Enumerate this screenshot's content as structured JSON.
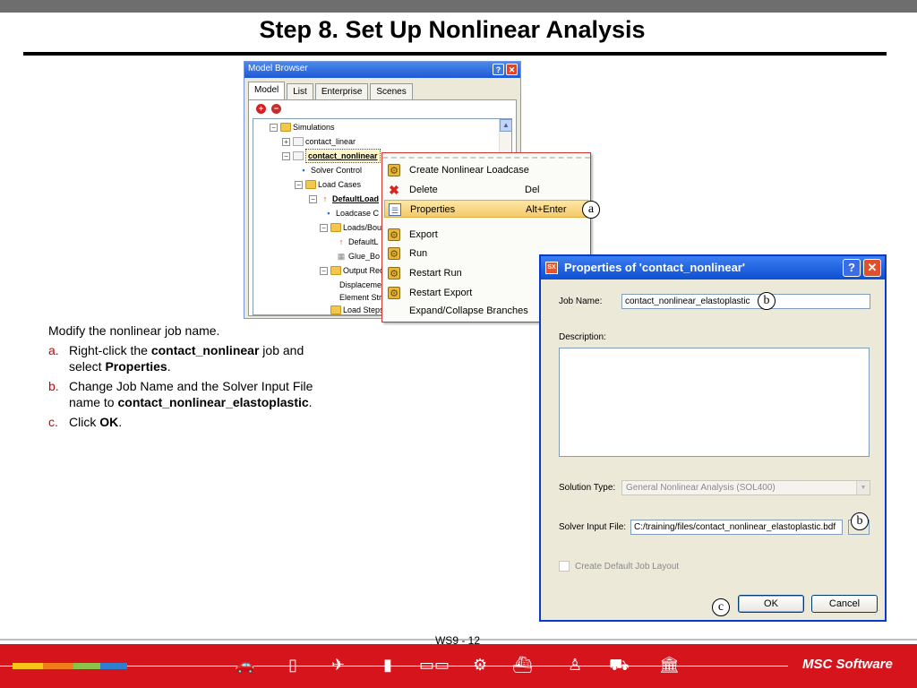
{
  "slide": {
    "title": "Step 8. Set Up Nonlinear Analysis",
    "page_number": "WS9 - 12"
  },
  "model_browser": {
    "title": "Model Browser",
    "tabs": [
      "Model",
      "List",
      "Enterprise",
      "Scenes"
    ],
    "active_tab": "Model",
    "tree": [
      {
        "label": "Simulations",
        "icon": "folder-open-icon"
      },
      {
        "label": "contact_linear",
        "icon": "document-icon"
      },
      {
        "label": "contact_nonlinear",
        "icon": "document-icon",
        "selected": true
      },
      {
        "label": "Solver Control",
        "icon": "solver-control-icon"
      },
      {
        "label": "Load Cases",
        "icon": "folder-open-icon"
      },
      {
        "label": "DefaultLoad",
        "icon": "loadcase-icon"
      },
      {
        "label": "Loadcase C",
        "icon": "solver-control-icon"
      },
      {
        "label": "Loads/Boun",
        "icon": "folder-open-icon"
      },
      {
        "label": "DefaultL",
        "icon": "load-icon"
      },
      {
        "label": "Glue_Bo",
        "icon": "grid-icon"
      },
      {
        "label": "Output Req",
        "icon": "folder-open-icon"
      },
      {
        "label": "Displacemen",
        "icon": "none"
      },
      {
        "label": "Element Str",
        "icon": "none"
      },
      {
        "label": "Load Steps",
        "icon": "folder-icon"
      }
    ]
  },
  "context_menu": {
    "items": [
      {
        "label": "Create Nonlinear Loadcase",
        "shortcut": "",
        "icon": "gear-icon"
      },
      {
        "label": "Delete",
        "shortcut": "Del",
        "icon": "delete-x-icon"
      },
      {
        "label": "Properties",
        "shortcut": "Alt+Enter",
        "icon": "properties-table-icon",
        "highlighted": true
      },
      {
        "label": "Export",
        "shortcut": "",
        "icon": "gear-icon"
      },
      {
        "label": "Run",
        "shortcut": "",
        "icon": "gear-icon"
      },
      {
        "label": "Restart Run",
        "shortcut": "",
        "icon": "gear-icon"
      },
      {
        "label": "Restart Export",
        "shortcut": "",
        "icon": "gear-icon"
      },
      {
        "label": "Expand/Collapse Branches",
        "shortcut": "",
        "icon": "none"
      }
    ]
  },
  "callouts": {
    "a": "a",
    "b1": "b",
    "b2": "b",
    "c": "c"
  },
  "instructions": {
    "intro": "Modify the nonlinear job name.",
    "steps": [
      {
        "marker": "a.",
        "parts": [
          "Right-click the ",
          "contact_nonlinear",
          " job and select ",
          "Properties",
          "."
        ]
      },
      {
        "marker": "b.",
        "parts": [
          "Change Job Name and the Solver Input File name to ",
          "contact_nonlinear_elastoplastic",
          "."
        ]
      },
      {
        "marker": "c.",
        "parts": [
          "Click ",
          "OK",
          "."
        ]
      }
    ]
  },
  "properties_dialog": {
    "title": "Properties of 'contact_nonlinear'",
    "app_icon": "SX",
    "help_label": "?",
    "close_label": "✕",
    "job_name_label": "Job Name:",
    "job_name_value": "contact_nonlinear_elastoplastic",
    "description_label": "Description:",
    "solution_type_label": "Solution Type:",
    "solution_type_value": "General Nonlinear Analysis (SOL400)",
    "solver_input_label": "Solver Input File:",
    "solver_input_value": "C:/training/files/contact_nonlinear_elastoplastic.bdf",
    "create_layout_label": "Create Default Job Layout",
    "ok_label": "OK",
    "cancel_label": "Cancel"
  },
  "footer": {
    "brand": "MSC Software",
    "colors": [
      "#f5c518",
      "#f07d1b",
      "#8bc34a",
      "#2f7fd1"
    ],
    "icons": [
      "car-icon",
      "phone-icon",
      "airplane-icon",
      "bottle-icon",
      "train-icon",
      "gear-icon",
      "ship-icon",
      "astronaut-icon",
      "truck-icon",
      "building-icon"
    ]
  }
}
